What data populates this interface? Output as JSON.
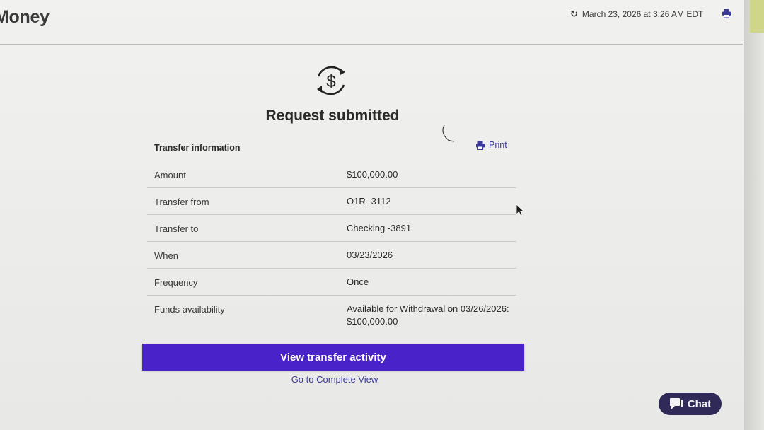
{
  "header": {
    "brand": "Money",
    "timestamp": "March 23, 2026 at 3:26 AM EDT",
    "refresh_icon": "refresh-icon",
    "print_icon": "printer-icon"
  },
  "confirmation": {
    "icon": "dollar-transfer-icon",
    "title": "Request submitted"
  },
  "transfer_info": {
    "heading": "Transfer information",
    "print_label": "Print",
    "rows": [
      {
        "label": "Amount",
        "value": "$100,000.00"
      },
      {
        "label": "Transfer from",
        "value": "O1R -3112"
      },
      {
        "label": "Transfer to",
        "value": "Checking -3891"
      },
      {
        "label": "When",
        "value": "03/23/2026"
      },
      {
        "label": "Frequency",
        "value": "Once"
      },
      {
        "label": "Funds availability",
        "value_line1": "Available for Withdrawal on 03/26/2026:",
        "value_line2": "$100,000.00"
      }
    ]
  },
  "actions": {
    "primary": "View transfer activity",
    "secondary": "Go to Complete View"
  },
  "chat": {
    "label": "Chat",
    "icon": "chat-bubble-icon"
  },
  "colors": {
    "accent": "#4a22c9",
    "link": "#3c3a9a",
    "chat_bg": "#2f2a58"
  }
}
